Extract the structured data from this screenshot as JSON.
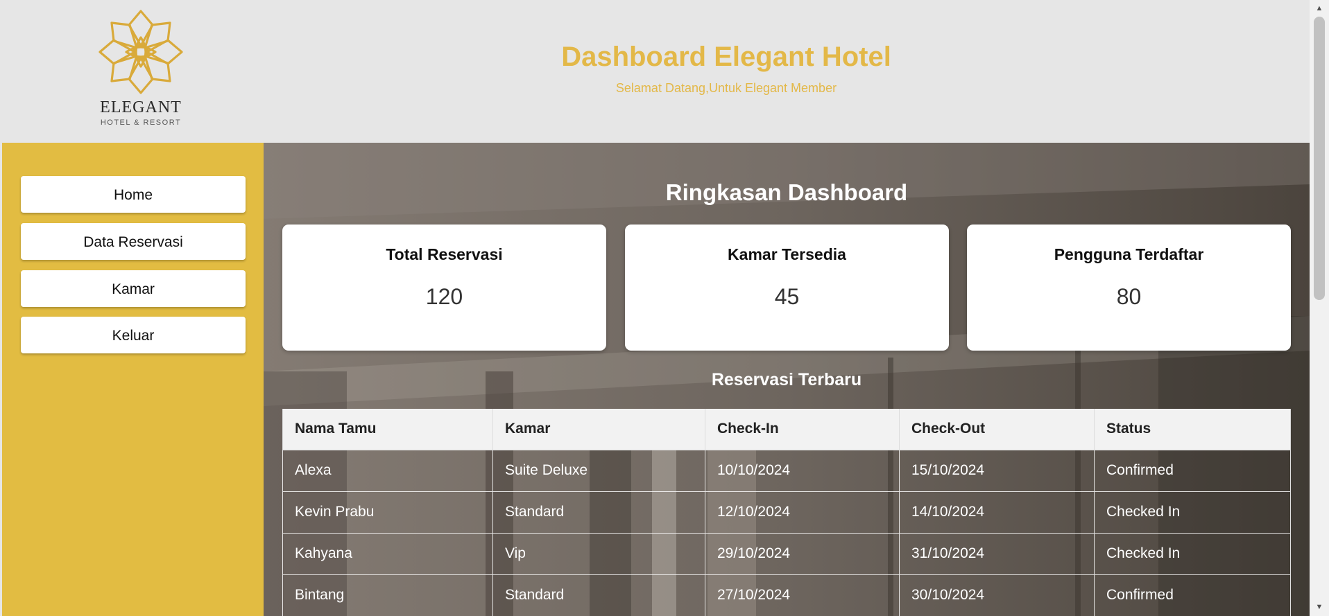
{
  "header": {
    "logo_word": "ELEGANT",
    "logo_sub": "HOTEL & RESORT",
    "title": "Dashboard Elegant Hotel",
    "subtitle": "Selamat Datang,Untuk Elegant Member"
  },
  "colors": {
    "accent": "#e3b848",
    "sidebar": "#e2bc42",
    "header_bg": "#e6e6e6"
  },
  "sidebar": {
    "items": [
      {
        "label": "Home"
      },
      {
        "label": "Data Reservasi"
      },
      {
        "label": "Kamar"
      },
      {
        "label": "Keluar"
      }
    ]
  },
  "summary": {
    "title": "Ringkasan Dashboard",
    "cards": [
      {
        "label": "Total Reservasi",
        "value": "120"
      },
      {
        "label": "Kamar Tersedia",
        "value": "45"
      },
      {
        "label": "Pengguna Terdaftar",
        "value": "80"
      }
    ]
  },
  "recent": {
    "title": "Reservasi Terbaru",
    "columns": [
      "Nama Tamu",
      "Kamar",
      "Check-In",
      "Check-Out",
      "Status"
    ],
    "rows": [
      [
        "Alexa",
        "Suite Deluxe",
        "10/10/2024",
        "15/10/2024",
        "Confirmed"
      ],
      [
        "Kevin Prabu",
        "Standard",
        "12/10/2024",
        "14/10/2024",
        "Checked In"
      ],
      [
        "Kahyana",
        "Vip",
        "29/10/2024",
        "31/10/2024",
        "Checked In"
      ],
      [
        "Bintang",
        "Standard",
        "27/10/2024",
        "30/10/2024",
        "Confirmed"
      ]
    ]
  },
  "icons": {
    "logo": "lotus-logo-icon",
    "scroll_up": "scroll-up-arrow-icon",
    "scroll_down": "scroll-down-arrow-icon"
  }
}
